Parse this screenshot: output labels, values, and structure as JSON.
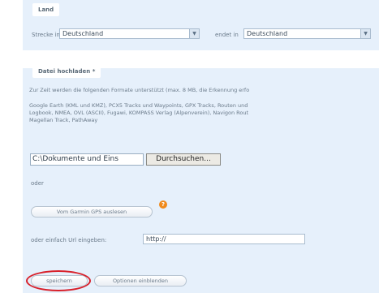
{
  "land": {
    "legend": "Land",
    "start_label": "Strecke in",
    "start_value": "Deutschland",
    "end_label": "endet in",
    "end_value": "Deutschland"
  },
  "upload": {
    "legend": "Datei hochladen *",
    "intro": "Zur Zeit werden die folgenden Formate unterstützt (max. 8 MB, die Erkennung erfo",
    "formats_line1": "Google Earth (KML und KMZ), PCX5 Tracks und Waypoints, GPX Tracks, Routen und",
    "formats_line2": "Logbook, NMEA, OVL (ASCII), Fugawi, KOMPASS Verlag (Alpenverein), Navigon Rout",
    "formats_line3": "Magellan Track, PathAway",
    "file_value": "C:\\Dokumente und Eins",
    "browse_label": "Durchsuchen...",
    "or_label": "oder",
    "garmin_label": "Vom Garmin GPS auslesen",
    "help_symbol": "?",
    "url_label": "oder einfach Url eingeben:",
    "url_value": "http://"
  },
  "actions": {
    "save_label": "speichern",
    "options_label": "Optionen einblenden"
  },
  "colors": {
    "panel_bg": "#e6f0fb",
    "highlight": "#d8202a",
    "help_icon": "#f08a1c"
  }
}
